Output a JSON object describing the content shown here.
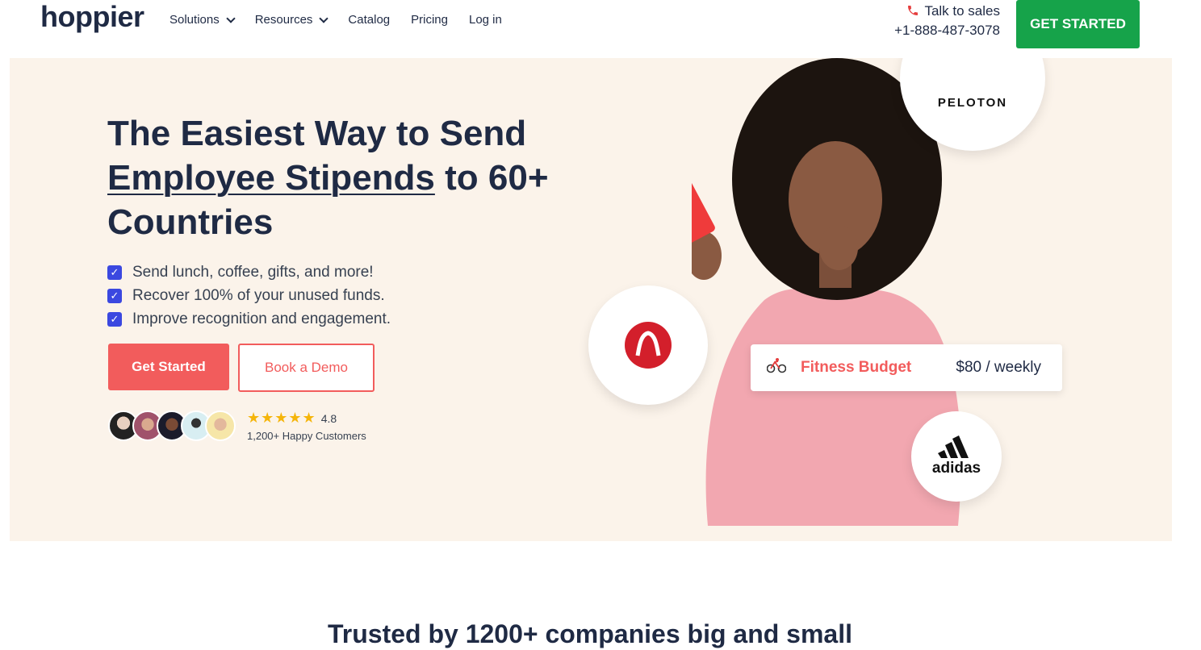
{
  "nav": {
    "logo": "hoppier",
    "links": [
      "Solutions",
      "Resources",
      "Catalog",
      "Pricing",
      "Log in"
    ],
    "sales_label": "Talk to sales",
    "sales_phone": "+1-888-487-3078",
    "cta": "GET STARTED"
  },
  "hero": {
    "headline_1": "The Easiest Way to Send",
    "headline_underlined": "Employee Stipends",
    "headline_2": "to 60+",
    "headline_3": "Countries",
    "checks": [
      "Send lunch, coffee, gifts, and more!",
      "Recover 100% of your unused funds.",
      "Improve recognition and engagement."
    ],
    "primary_button": "Get Started",
    "secondary_button": "Book a Demo",
    "rating": "4.8",
    "stars": "★★★★★",
    "customers": "1,200+ Happy Customers",
    "budget_label": "Fitness Budget",
    "budget_amount": "$80 / weekly",
    "peloton": "PELOTON",
    "adidas": "adidas"
  },
  "trusted": "Trusted by 1200+ companies big and small",
  "colors": {
    "brand_green": "#16a34a",
    "accent_coral": "#f25c5c",
    "hero_bg": "#fbf3ea",
    "check_blue": "#3b48e0"
  }
}
